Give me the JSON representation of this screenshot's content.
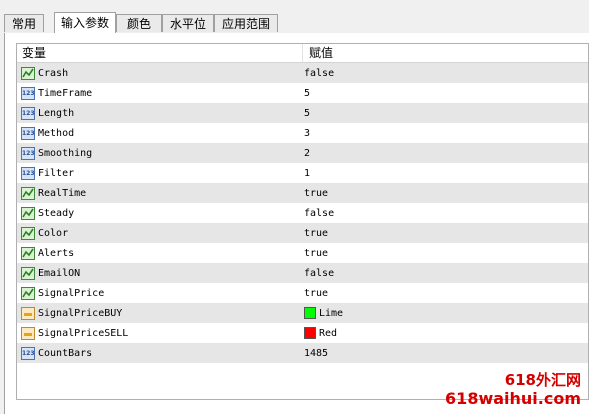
{
  "tabs": [
    "常用",
    "输入参数",
    "颜色",
    "水平位",
    "应用范围"
  ],
  "table": {
    "headers": [
      "变量",
      "赋值"
    ],
    "rows": [
      {
        "type": "bool",
        "name": "Crash",
        "value": "false"
      },
      {
        "type": "int",
        "name": "TimeFrame",
        "value": "5"
      },
      {
        "type": "int",
        "name": "Length",
        "value": "5"
      },
      {
        "type": "int",
        "name": "Method",
        "value": "3"
      },
      {
        "type": "int",
        "name": "Smoothing",
        "value": "2"
      },
      {
        "type": "int",
        "name": "Filter",
        "value": "1"
      },
      {
        "type": "bool",
        "name": "RealTime",
        "value": "true"
      },
      {
        "type": "bool",
        "name": "Steady",
        "value": "false"
      },
      {
        "type": "bool",
        "name": "Color",
        "value": "true"
      },
      {
        "type": "bool",
        "name": "Alerts",
        "value": "true"
      },
      {
        "type": "bool",
        "name": "EmailON",
        "value": "false"
      },
      {
        "type": "bool",
        "name": "SignalPrice",
        "value": "true"
      },
      {
        "type": "color",
        "name": "SignalPriceBUY",
        "value": "Lime",
        "swatch": "#00ff00"
      },
      {
        "type": "color",
        "name": "SignalPriceSELL",
        "value": "Red",
        "swatch": "#ff0000"
      },
      {
        "type": "int",
        "name": "CountBars",
        "value": "1485"
      }
    ],
    "int_icon_text": "123"
  },
  "watermark": {
    "line1": "618外汇网",
    "line2": "618waihui.com"
  }
}
